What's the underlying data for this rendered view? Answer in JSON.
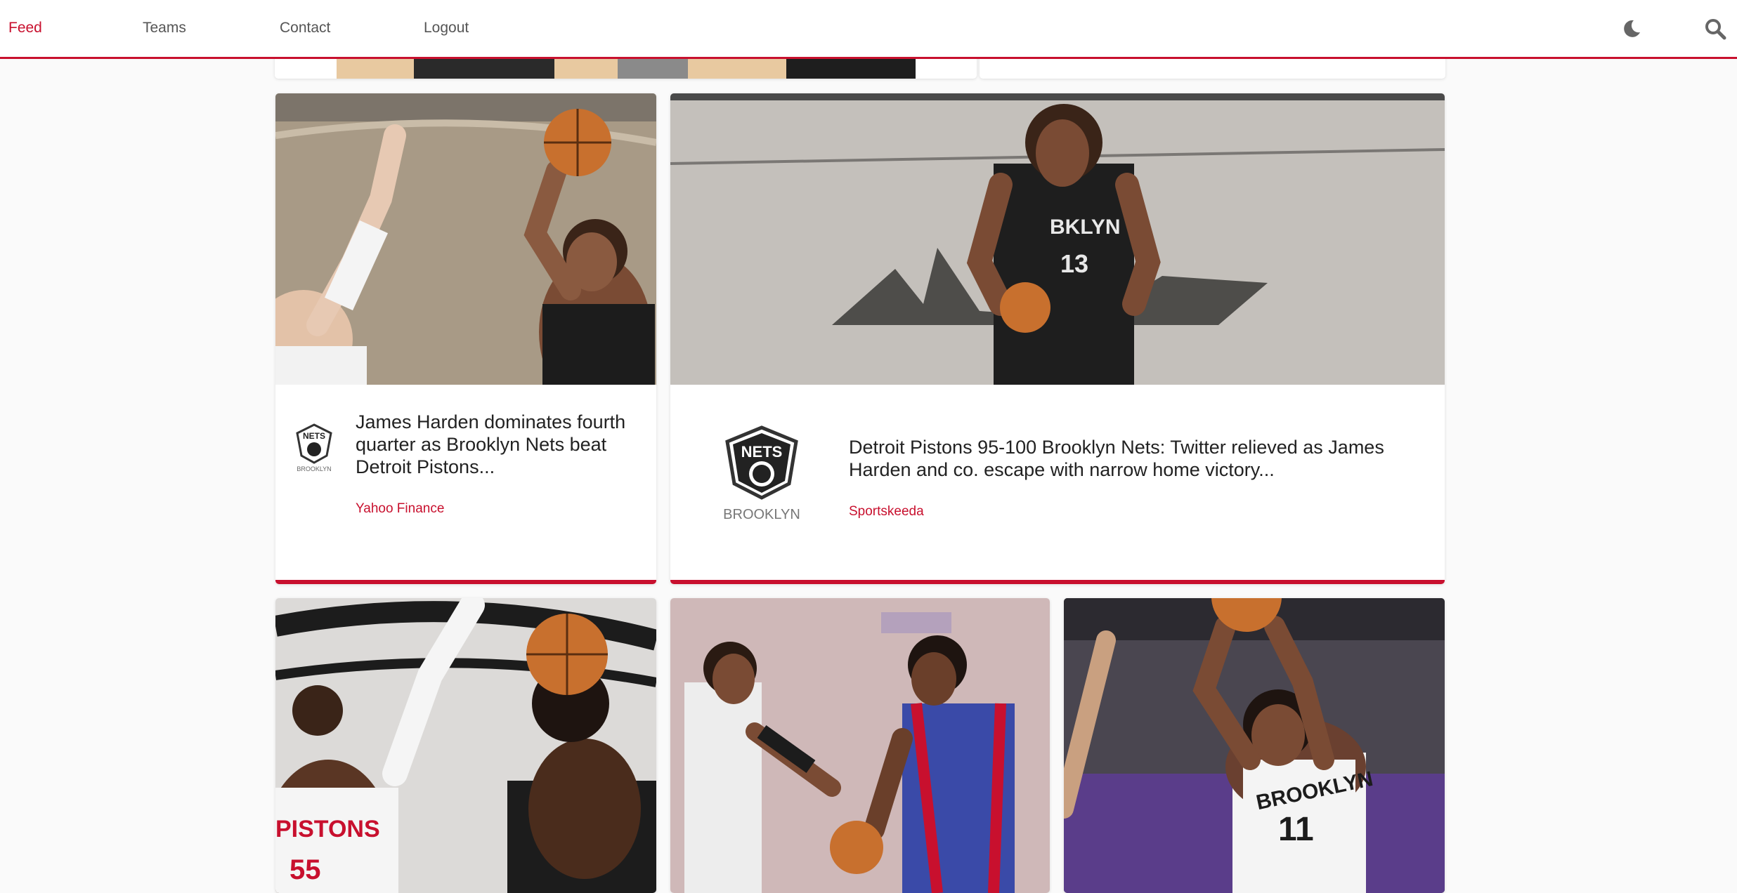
{
  "nav": {
    "links": [
      {
        "label": "Feed",
        "active": true
      },
      {
        "label": "Teams",
        "active": false
      },
      {
        "label": "Contact",
        "active": false
      },
      {
        "label": "Logout",
        "active": false
      }
    ],
    "icons": [
      "moon-icon",
      "search-icon"
    ],
    "accent_color": "#c8102e"
  },
  "feed": {
    "articles": [
      {
        "headline": "James Harden dominates fourth quarter as Brooklyn Nets beat Detroit Pistons...",
        "source": "Yahoo Finance",
        "logo_text": "NETS",
        "logo_subtext": "BROOKLYN"
      },
      {
        "headline": "Detroit Pistons 95-100 Brooklyn Nets: Twitter relieved as James Harden and co. escape with narrow home victory...",
        "source": "Sportskeeda",
        "logo_text": "NETS",
        "logo_subtext": "BROOKLYN"
      }
    ]
  },
  "photos": {
    "card1_number": "",
    "card2_jersey": "BKLYN",
    "card2_number": "13",
    "card3_jersey": "PISTONS",
    "card3_number": "55",
    "card5_jersey": "BROOKLYN",
    "card5_number": "11"
  }
}
